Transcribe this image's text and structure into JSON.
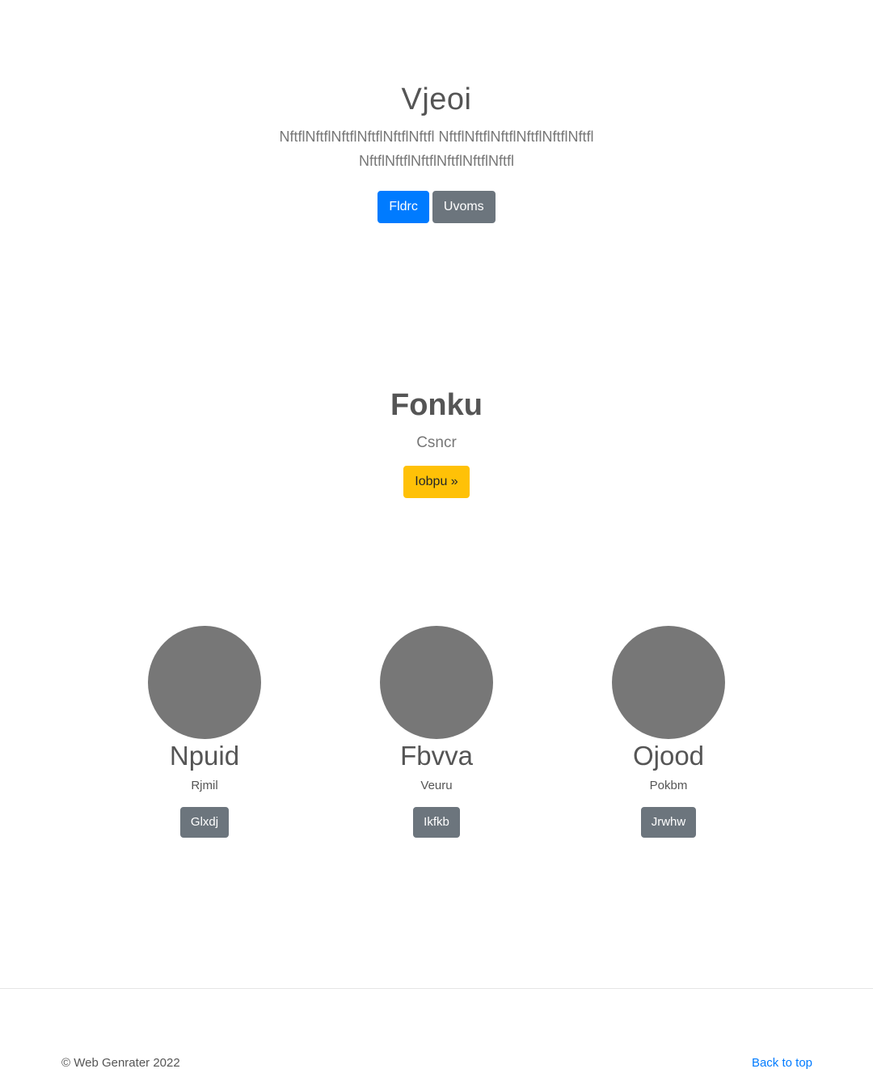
{
  "hero": {
    "title": "Vjeoi",
    "lead": "NftflNftflNftflNftflNftflNftfl NftflNftflNftflNftflNftflNftfl NftflNftflNftflNftflNftflNftfl",
    "primary_button": "Fldrc",
    "secondary_button": "Uvoms"
  },
  "feature": {
    "title": "Fonku",
    "subtitle": "Csncr",
    "button": "Iobpu »"
  },
  "profiles": [
    {
      "name": "Npuid",
      "role": "Rjmil",
      "button": "Glxdj"
    },
    {
      "name": "Fbvva",
      "role": "Veuru",
      "button": "Ikfkb"
    },
    {
      "name": "Ojood",
      "role": "Pokbm",
      "button": "Jrwhw"
    }
  ],
  "footer": {
    "copyright": "© Web Genrater 2022",
    "back_to_top": "Back to top"
  },
  "colors": {
    "primary": "#007bff",
    "secondary": "#6c757d",
    "warning": "#ffc107",
    "avatar": "#777777"
  }
}
